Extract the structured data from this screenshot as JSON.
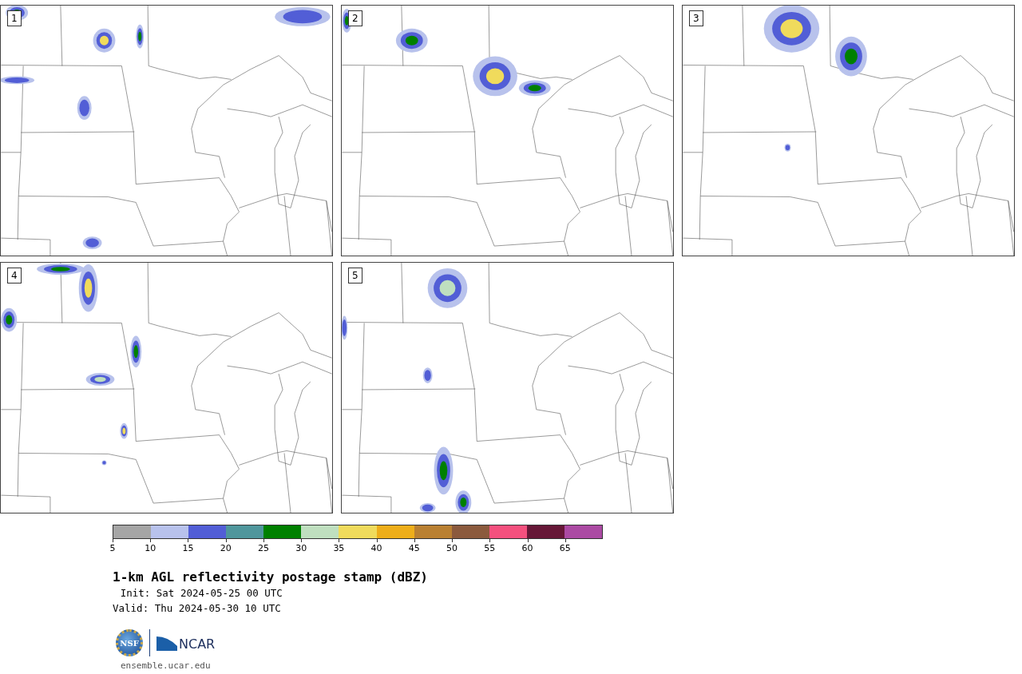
{
  "panels": [
    {
      "number": "1"
    },
    {
      "number": "2"
    },
    {
      "number": "3"
    },
    {
      "number": "4"
    },
    {
      "number": "5"
    }
  ],
  "colorbar": {
    "segments": [
      {
        "color": "#a5a5a5"
      },
      {
        "color": "#b8c2ec"
      },
      {
        "color": "#525ed6"
      },
      {
        "color": "#4f969c"
      },
      {
        "color": "#008000"
      },
      {
        "color": "#bfdfbf"
      },
      {
        "color": "#f0db5c"
      },
      {
        "color": "#eeae1a"
      },
      {
        "color": "#b98032"
      },
      {
        "color": "#8b5a3d"
      },
      {
        "color": "#f4507e"
      },
      {
        "color": "#661737"
      },
      {
        "color": "#ab4aa3"
      }
    ],
    "ticks": [
      "5",
      "10",
      "15",
      "20",
      "25",
      "30",
      "35",
      "40",
      "45",
      "50",
      "55",
      "60",
      "65"
    ]
  },
  "title": "1-km AGL reflectivity postage stamp (dBZ)",
  "init": "Init: Sat 2024-05-25 00 UTC",
  "valid": "Valid: Thu 2024-05-30 10 UTC",
  "logo": {
    "nsf": "NSF",
    "ncar": "NCAR"
  },
  "url": "ensemble.ucar.edu"
}
